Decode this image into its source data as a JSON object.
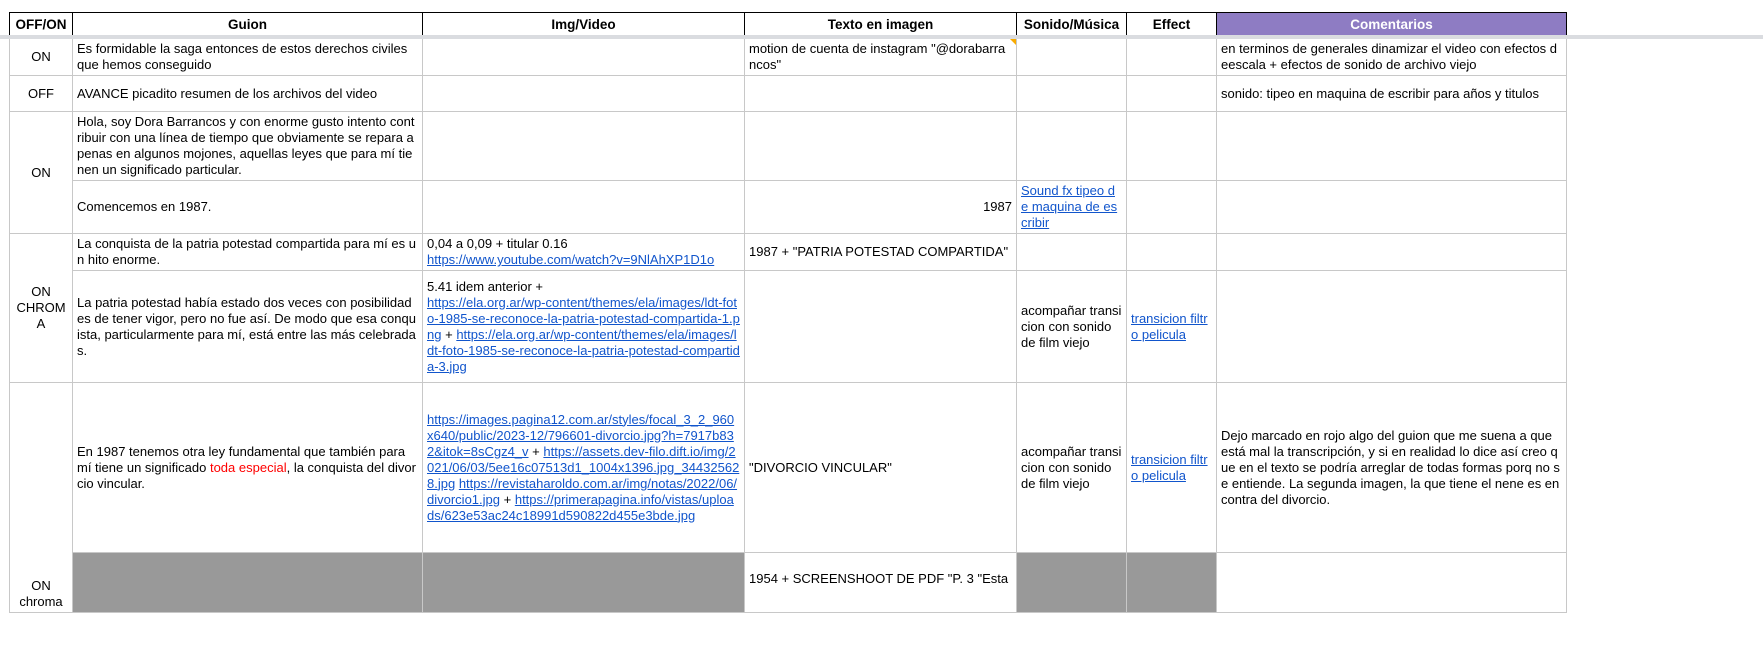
{
  "header": {
    "offon": "OFF/ON",
    "guion": "Guion",
    "img": "Img/Video",
    "texto": "Texto en imagen",
    "sonido": "Sonido/Música",
    "effect": "Effect",
    "comentarios": "Comentarios"
  },
  "rows": {
    "r1": {
      "offon": "ON",
      "guion": "Es formidable la saga entonces de estos derechos civiles que hemos conseguido",
      "texto": "motion de cuenta de instagram \"@dorabarrancos\"",
      "comentarios": "en terminos de generales dinamizar el video con efectos deescala  + efectos de sonido de archivo viejo"
    },
    "r2": {
      "offon": "OFF",
      "guion": "AVANCE picadito resumen de los archivos del video",
      "comentarios": "sonido: tipeo en maquina de escribir para años y titulos"
    },
    "r3": {
      "offon": "ON",
      "guion": "Hola, soy Dora Barrancos y con enorme gusto intento contribuir con una línea de tiempo que obviamente se repara apenas en algunos mojones, aquellas leyes que para mí tienen un significado particular."
    },
    "r4": {
      "guion": "Comencemos en 1987.",
      "texto": "1987",
      "sonido_link": "Sound fx tipeo de maquina de escribir"
    },
    "r5": {
      "offon_line1": "ON",
      "offon_line2": "CHROMA",
      "guion": "La conquista de la patria potestad compartida para mí es un hito enorme.",
      "img_text": "0,04 a 0,09 + titular 0.16",
      "img_link": "https://www.youtube.com/watch?v=9NlAhXP1D1o",
      "texto": "1987 + \"PATRIA POTESTAD COMPARTIDA\""
    },
    "r6": {
      "guion": "La patria potestad había estado dos veces con posibilidades de tener vigor, pero no fue así. De modo que esa conquista, particularmente para mí, está entre las más celebradas.",
      "img_text": "5.41 idem anterior +",
      "img_link1": "https://ela.org.ar/wp-content/themes/ela/images/ldt-foto-1985-se-reconoce-la-patria-potestad-compartida-1.png",
      "img_plus": " +",
      "img_link2": "https://ela.org.ar/wp-content/themes/ela/images/ldt-foto-1985-se-reconoce-la-patria-potestad-compartida-3.jpg",
      "sonido": "acompañar transicion con sonido de film viejo",
      "effect_link": "transicion filtro pelicula"
    },
    "r7": {
      "offon_line1": "ON",
      "offon_line2": "chroma",
      "guion_a": "En 1987 tenemos otra ley fundamental que también para mí tiene un significado ",
      "guion_red": "toda especial",
      "guion_b": ", la conquista del divorcio vincular.",
      "img_link1": "https://images.pagina12.com.ar/styles/focal_3_2_960x640/public/2023-12/796601-divorcio.jpg?h=7917b832&itok=8sCgz4_v",
      "img_plus1": " +",
      "img_link2": "https://assets.dev-filo.dift.io/img/2021/06/03/5ee16c07513d1_1004x1396.jpg_344325628.jpg",
      "img_link3": "https://revistaharoldo.com.ar/img/notas/2022/06/divorcio1.jpg",
      "img_plus2": "  +",
      "img_link4": "https://primerapagina.info/vistas/uploads/623e53ac24c18991d590822d455e3bde.jpg",
      "texto": "\"DIVORCIO VINCULAR\"",
      "sonido": "acompañar transicion con sonido de film viejo",
      "effect_link": "transicion filtro pelicula",
      "comentarios": "Dejo marcado en rojo algo del guion que me suena a que está mal la transcripción, y si en realidad lo dice así creo que en el texto se podría arreglar de todas formas porq no se entiende. La segunda imagen, la que tiene el nene es en contra del divorcio."
    },
    "r8": {
      "texto": "1954 + SCREENSHOOT DE PDF \"P. 3 \"Esta"
    }
  },
  "colors": {
    "comments_header": "#8e7cc3",
    "link": "#1155cc",
    "highlight_red": "#ff0000",
    "gray_cell": "#999999"
  }
}
